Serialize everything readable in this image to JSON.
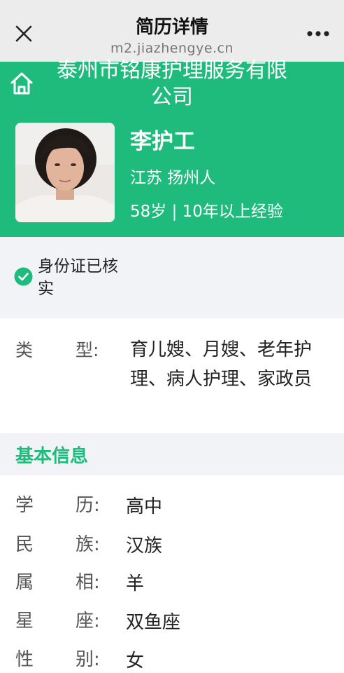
{
  "topbar": {
    "title": "简历详情",
    "url": "m2.jiazhengye.cn"
  },
  "hero": {
    "company": "泰州市铭康护理服务有限公司",
    "name": "李护工",
    "origin": "江苏 扬州人",
    "meta": "58岁 | 10年以上经验"
  },
  "verify": {
    "text": "身份证已核实"
  },
  "type": {
    "label_1": "类",
    "label_2": "型:",
    "value": "育儿嫂、月嫂、老年护理、病人护理、家政员"
  },
  "basic": {
    "title": "基本信息",
    "rows": [
      {
        "l1": "学",
        "l2": "历:",
        "value": "高中"
      },
      {
        "l1": "民",
        "l2": "族:",
        "value": "汉族"
      },
      {
        "l1": "属",
        "l2": "相:",
        "value": "羊"
      },
      {
        "l1": "星",
        "l2": "座:",
        "value": "双鱼座"
      },
      {
        "l1": "性",
        "l2": "别:",
        "value": "女"
      }
    ]
  },
  "colors": {
    "brand_green": "#1fbb7c",
    "section_bg": "#f2f3f7",
    "topbar_bg": "#ececec"
  },
  "icons": {
    "close": "close-icon",
    "more": "more-icon",
    "home": "home-icon",
    "verified": "check-circle-icon"
  }
}
